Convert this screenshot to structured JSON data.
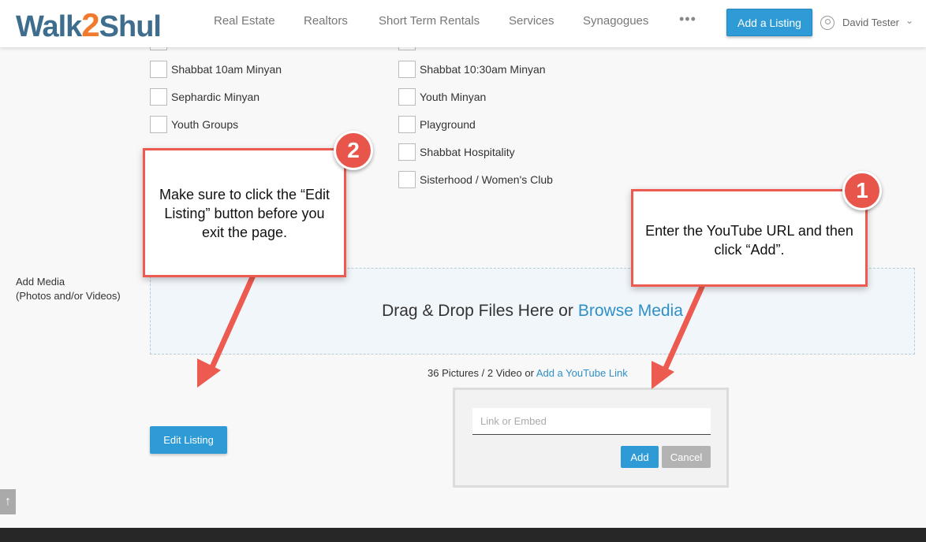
{
  "header": {
    "logo": {
      "part1": "Walk",
      "part2": "2",
      "part3": "Shul"
    },
    "nav": [
      "Real Estate",
      "Realtors",
      "Short Term Rentals",
      "Services",
      "Synagogues"
    ],
    "more": "•••",
    "add_listing_label": "Add a Listing",
    "user_name": "David Tester",
    "user_chevron": "⌄"
  },
  "amenities": {
    "left": [
      "Shabbat 10am Minyan",
      "Sephardic Minyan",
      "Youth Groups"
    ],
    "right": [
      "Shabbat 10:30am Minyan",
      "Youth Minyan",
      "Playground",
      "Shabbat Hospitality",
      "Sisterhood / Women's Club"
    ]
  },
  "media": {
    "label_line1": "Add Media",
    "label_line2": "(Photos and/or Videos)",
    "drop_text": "Drag & Drop Files Here or",
    "browse_text": "Browse Media",
    "count_text": "36 Pictures / 2 Video or",
    "youtube_link": "Add a YouTube Link"
  },
  "youtube_popup": {
    "placeholder": "Link or Embed",
    "add_label": "Add",
    "cancel_label": "Cancel"
  },
  "edit_listing_label": "Edit Listing",
  "scroll_top_icon": "↑",
  "callouts": {
    "one": {
      "badge": "1",
      "text": "Enter the YouTube URL and then click “Add”."
    },
    "two": {
      "badge": "2",
      "text": "Make sure to click the “Edit Listing” button before you exit the page."
    }
  },
  "colors": {
    "accent": "#2f9bd6",
    "callout": "#ec5a50",
    "logo_blue": "#3e6d8e",
    "logo_orange": "#f07b2e"
  }
}
